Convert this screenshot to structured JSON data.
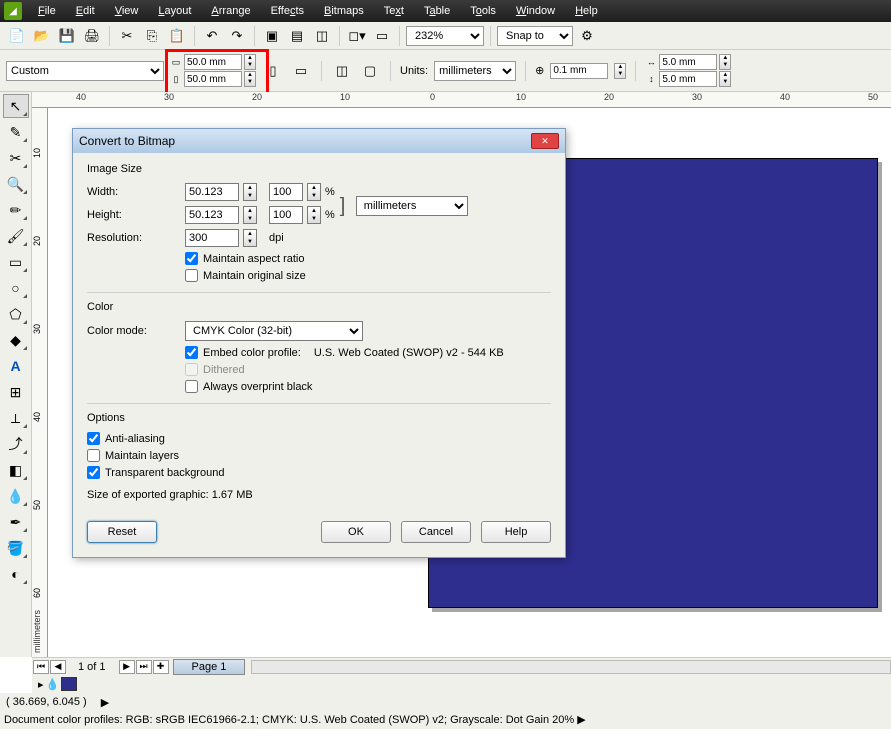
{
  "menu": [
    "File",
    "Edit",
    "View",
    "Layout",
    "Arrange",
    "Effects",
    "Bitmaps",
    "Text",
    "Table",
    "Tools",
    "Window",
    "Help"
  ],
  "toolbar": {
    "zoom": "232%",
    "snap": "Snap to"
  },
  "propbar": {
    "paper": "Custom",
    "w": "50.0 mm",
    "h": "50.0 mm",
    "units_lbl": "Units:",
    "units_val": "millimeters",
    "nudge": "0.1 mm",
    "dup_x": "5.0 mm",
    "dup_y": "5.0 mm"
  },
  "ruler_h": [
    40,
    30,
    20,
    10,
    0,
    10,
    20,
    30,
    40,
    50
  ],
  "ruler_v": [
    10,
    20,
    30,
    40,
    50,
    60
  ],
  "ruler_v_label": "millimeters",
  "dialog": {
    "title": "Convert to Bitmap",
    "sec_size": "Image Size",
    "width_lbl": "Width:",
    "height_lbl": "Height:",
    "res_lbl": "Resolution:",
    "width_val": "50.123",
    "height_val": "50.123",
    "width_pct": "100",
    "height_pct": "100",
    "pct_sym": "%",
    "units": "millimeters",
    "res_val": "300",
    "dpi": "dpi",
    "maintain_ar": "Maintain aspect ratio",
    "maintain_orig": "Maintain original size",
    "sec_color": "Color",
    "colormode_lbl": "Color mode:",
    "colormode_val": "CMYK Color (32-bit)",
    "embed": "Embed color profile:",
    "profile": "U.S. Web Coated (SWOP) v2 - 544 KB",
    "dithered": "Dithered",
    "overprint": "Always overprint black",
    "sec_opts": "Options",
    "aa": "Anti-aliasing",
    "layers": "Maintain layers",
    "trans": "Transparent background",
    "size_info": "Size of exported graphic: 1.67 MB",
    "reset": "Reset",
    "ok": "OK",
    "cancel": "Cancel",
    "help": "Help"
  },
  "page_nav": {
    "count": "1 of 1",
    "tab": "Page 1"
  },
  "status": {
    "coords": "( 36.669, 6.045 )",
    "profiles": "Document color profiles: RGB: sRGB IEC61966-2.1; CMYK: U.S. Web Coated (SWOP) v2; Grayscale: Dot Gain 20%"
  }
}
